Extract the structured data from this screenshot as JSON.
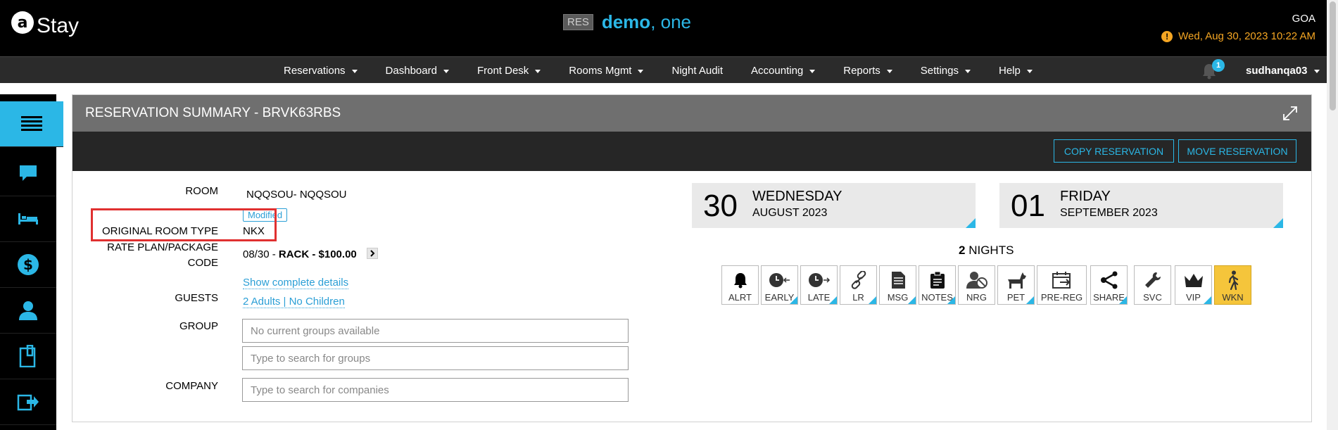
{
  "header": {
    "logo_letter": "a",
    "logo_text": "Stay",
    "env_badge": "RES",
    "property_bold": "demo",
    "property_rest": ", one",
    "location": "GOA",
    "datetime": "Wed, Aug 30, 2023 10:22 AM",
    "warning_icon": "!"
  },
  "nav": {
    "items": [
      "Reservations",
      "Dashboard",
      "Front Desk",
      "Rooms Mgmt",
      "Night Audit",
      "Accounting",
      "Reports",
      "Settings",
      "Help"
    ],
    "notification_count": "1",
    "username": "sudhanqa03"
  },
  "sidebar": {
    "icons": [
      "menu-icon",
      "chat-icon",
      "bed-icon",
      "dollar-icon",
      "person-icon",
      "clipboard-icon",
      "export-icon"
    ]
  },
  "panel": {
    "title": "RESERVATION SUMMARY - BRVK63RBS",
    "copy_btn": "COPY RESERVATION",
    "move_btn": "MOVE RESERVATION"
  },
  "details": {
    "room_label": "ROOM",
    "room_value": "NQQSOU- NQQSOU",
    "modified_tag": "Modified",
    "orig_room_type_label": "ORIGINAL ROOM TYPE",
    "orig_room_type_value": "NKX",
    "rate_label_1": "RATE PLAN/PACKAGE",
    "rate_label_2": "CODE",
    "rate_date": "08/30 - ",
    "rate_value": "RACK - $100.00",
    "show_details": "Show complete details",
    "guests_label": "GUESTS",
    "guests_value": "2 Adults | No Children",
    "group_label": "GROUP",
    "group_placeholder": "No current groups available",
    "group_search_placeholder": "Type to search for groups",
    "company_label": "COMPANY",
    "company_placeholder": "Type to search for companies"
  },
  "dates": {
    "arrival": {
      "num": "30",
      "day": "WEDNESDAY",
      "month": "AUGUST 2023"
    },
    "departure": {
      "num": "01",
      "day": "FRIDAY",
      "month": "SEPTEMBER 2023"
    },
    "nights_count": "2",
    "nights_label": "NIGHTS"
  },
  "flags": [
    {
      "label": "ALRT",
      "icon": "bell-icon"
    },
    {
      "label": "EARLY",
      "icon": "clock-early-icon"
    },
    {
      "label": "LATE",
      "icon": "clock-late-icon"
    },
    {
      "label": "LR",
      "icon": "link-icon"
    },
    {
      "label": "MSG",
      "icon": "document-icon"
    },
    {
      "label": "NOTES",
      "icon": "clipboard-icon"
    },
    {
      "label": "NRG",
      "icon": "no-person-icon"
    },
    {
      "label": "PET",
      "icon": "dog-icon"
    },
    {
      "label": "PRE-REG",
      "icon": "calendar-icon"
    },
    {
      "label": "SHARE",
      "icon": "share-icon"
    },
    {
      "label": "SVC",
      "icon": "wrench-icon"
    },
    {
      "label": "VIP",
      "icon": "crown-icon"
    },
    {
      "label": "WKN",
      "icon": "walk-icon"
    }
  ],
  "colors": {
    "accent": "#2bb7e6",
    "warning": "#f5a623",
    "highlight": "#e03030",
    "active_flag": "#f5c53b"
  }
}
